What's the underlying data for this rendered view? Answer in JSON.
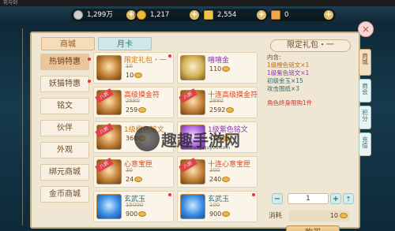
{
  "window": {
    "title": "花与剑"
  },
  "resources": [
    {
      "name": "silver-icon",
      "value": "1,299万",
      "color": "#c9c9c9"
    },
    {
      "name": "gold-coin-icon",
      "value": "1,217",
      "color": "#f0b93a"
    },
    {
      "name": "ingot-icon",
      "value": "2,554",
      "color": "#f1c24f"
    },
    {
      "name": "bound-ingot-icon",
      "value": "0",
      "color": "#f0a94a"
    }
  ],
  "tabs": [
    {
      "label": "商城"
    },
    {
      "label": "月卡"
    }
  ],
  "sidebar": [
    {
      "label": "热销特惠"
    },
    {
      "label": "妖猫特惠"
    },
    {
      "label": "铭文"
    },
    {
      "label": "伙伴"
    },
    {
      "label": "外观"
    },
    {
      "label": "绑元商城"
    },
    {
      "label": "金币商城"
    }
  ],
  "items": [
    {
      "name": "限定礼包・一",
      "count": "",
      "old": "10",
      "price": "10",
      "tag": "",
      "icon": "brown",
      "color": "orange"
    },
    {
      "name": "嘻嘻金",
      "count": "",
      "old": "",
      "price": "110",
      "tag": "",
      "icon": "jade",
      "color": ""
    },
    {
      "name": "高级摸金符",
      "count": "",
      "old": "2880",
      "price": "259",
      "tag": "八折",
      "icon": "brown",
      "color": "red"
    },
    {
      "name": "十连高级摸金符",
      "count": "",
      "old": "2880",
      "price": "2592",
      "tag": "八折",
      "icon": "brown",
      "color": "red"
    },
    {
      "name": "1级橙色铭文",
      "count": "",
      "old": "",
      "price": "360",
      "tag": "八折",
      "icon": "brown",
      "color": "orange"
    },
    {
      "name": "1级紫色铭文",
      "count": "",
      "old": "",
      "price": "100",
      "tag": "",
      "icon": "purple",
      "color": ""
    },
    {
      "name": "心意宝匣",
      "count": "",
      "old": "30",
      "price": "24",
      "tag": "八折",
      "icon": "brown",
      "color": "red"
    },
    {
      "name": "十连心意宝匣",
      "count": "",
      "old": "300",
      "price": "240",
      "tag": "八折",
      "icon": "brown",
      "color": "red"
    },
    {
      "name": "玄武玉",
      "count": "",
      "old": "15000",
      "price": "900",
      "tag": "",
      "icon": "blue",
      "color": ""
    },
    {
      "name": "玄武玉",
      "count": "",
      "old": "100",
      "price": "900",
      "tag": "",
      "icon": "blue",
      "color": ""
    }
  ],
  "detail": {
    "title": "限定礼包・一",
    "label": "内含:",
    "contents": [
      "1级橙色铭文×1",
      "1级紫色铭文×1",
      "初级金玉×15",
      "攻击图纸×3"
    ],
    "limit": "角色终身限购1件",
    "quantity": "1",
    "cost_label": "消耗",
    "cost_value": "10",
    "buy_label": "购买"
  },
  "right_tabs": [
    {
      "label": "商城"
    },
    {
      "label": "商会"
    },
    {
      "label": "积分"
    },
    {
      "label": "充值"
    }
  ],
  "watermark": {
    "main": "趣趣手游网",
    "sub": "www.ququyou.com"
  }
}
